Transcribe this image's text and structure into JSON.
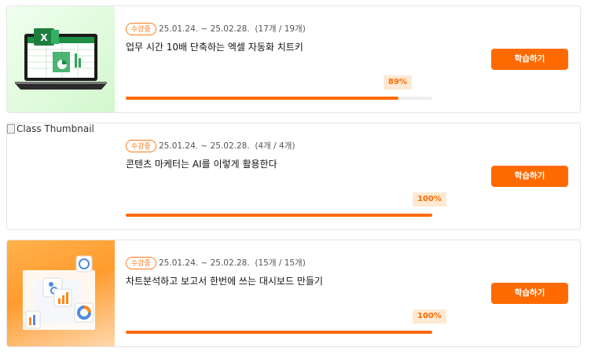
{
  "courses": [
    {
      "badge": "수강중",
      "dates": "25.01.24. ~ 25.02.28.",
      "count": "(17개 / 19개)",
      "title": "업무 시간 10배 단축하는 엑셀 자동화 치트키",
      "progress": 89,
      "progress_label": "89%",
      "button_label": "학습하기",
      "thumb_icon": "excel-laptop-icon"
    },
    {
      "badge": "수강중",
      "dates": "25.01.24. ~ 25.02.28.",
      "count": "(4개 / 4개)",
      "title": "콘텐츠 마케터는 AI를 이렇게 활용한다",
      "progress": 100,
      "progress_label": "100%",
      "button_label": "학습하기",
      "thumb_alt": "Class Thumbnail"
    },
    {
      "badge": "수강중",
      "dates": "25.01.24. ~ 25.02.28.",
      "count": "(15개 / 15개)",
      "title": "차트분석하고 보고서 한번에 쓰는 대시보드 만들기",
      "progress": 100,
      "progress_label": "100%",
      "button_label": "학습하기",
      "thumb_icon": "dashboard-charts-icon"
    }
  ],
  "colors": {
    "accent": "#ff6a00",
    "badge_border": "#ff7a1a",
    "pct_bg": "#ffe9d3"
  }
}
